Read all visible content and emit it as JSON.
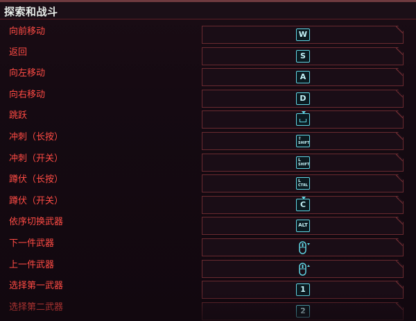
{
  "section": {
    "title": "探索和战斗"
  },
  "bindings": [
    {
      "label": "向前移动",
      "key": "W",
      "kind": "key"
    },
    {
      "label": "返回",
      "key": "S",
      "kind": "key"
    },
    {
      "label": "向左移动",
      "key": "A",
      "kind": "key"
    },
    {
      "label": "向右移动",
      "key": "D",
      "kind": "key"
    },
    {
      "label": "跳跃",
      "key": "SPACE",
      "kind": "space"
    },
    {
      "label": "冲刺（长按）",
      "key": "SHIFT",
      "kind": "shift-hold"
    },
    {
      "label": "冲刺（开关）",
      "key": "SHIFT",
      "kind": "shift"
    },
    {
      "label": "蹲伏（长按）",
      "key": "CTRL",
      "kind": "ctrl"
    },
    {
      "label": "蹲伏（开关）",
      "key": "C",
      "kind": "hold"
    },
    {
      "label": "依序切换武器",
      "key": "ALT",
      "kind": "alt"
    },
    {
      "label": "下一件武器",
      "key": "mouse-scroll-down-icon",
      "kind": "mouse"
    },
    {
      "label": "上一件武器",
      "key": "mouse-scroll-up-icon",
      "kind": "mouse"
    },
    {
      "label": "选择第一武器",
      "key": "1",
      "kind": "key"
    },
    {
      "label": "选择第二武器",
      "key": "2",
      "kind": "key"
    }
  ],
  "colors": {
    "label": "#ff4b44",
    "keycap": "#5fd6e4",
    "border": "#6a2a30",
    "title": "#e7ece8"
  }
}
